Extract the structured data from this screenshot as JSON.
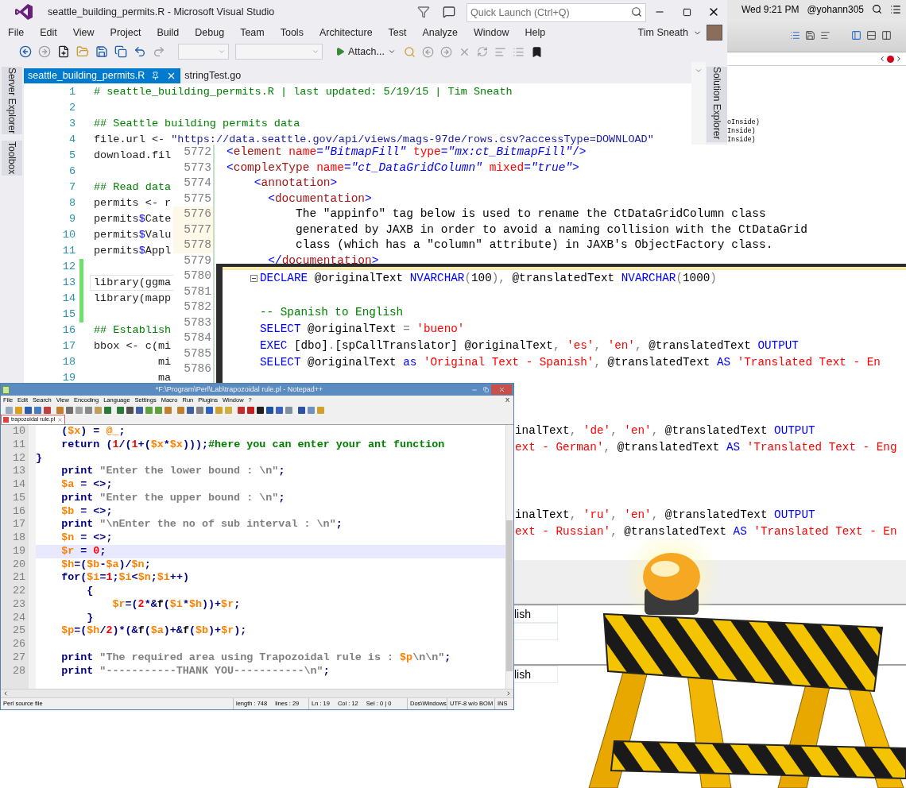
{
  "vs_window": {
    "title": "seattle_building_permits.R - Microsoft Visual Studio",
    "quick_launch": {
      "placeholder": "Quick Launch (Ctrl+Q)"
    },
    "menu": [
      "File",
      "Edit",
      "View",
      "Project",
      "Build",
      "Debug",
      "Team",
      "Tools",
      "Architecture",
      "Test",
      "Analyze",
      "Window",
      "Help"
    ],
    "user": "Tim Sneath",
    "toolbar": {
      "attach": "Attach..."
    },
    "tabs": [
      {
        "label": "seattle_building_permits.R",
        "selected": true
      },
      {
        "label": "stringTest.go",
        "selected": false
      }
    ],
    "left_tool_tabs": [
      "Server Explorer",
      "Toolbox"
    ],
    "right_tool_tab": "Solution Explorer",
    "editor": {
      "lines": [
        {
          "number": "1",
          "changed": false,
          "current": false,
          "tokens": [
            {
              "kind": "c",
              "text": "# seattle_building_permits.R | last updated: 5/19/15 | Tim Sneath"
            }
          ]
        },
        {
          "number": "2",
          "changed": false,
          "current": false
        },
        {
          "number": "3",
          "changed": false,
          "current": false,
          "tokens": [
            {
              "kind": "c",
              "text": "## Seattle building permits data"
            }
          ]
        },
        {
          "number": "4",
          "changed": false,
          "current": false,
          "tokens": [
            {
              "kind": "p",
              "text": "file.url <- "
            },
            {
              "kind": "s",
              "text": "\"https://data.seattle.gov/api/views/mags-97de/rows.csv?accessType=DOWNLOAD\""
            }
          ]
        },
        {
          "number": "5",
          "changed": false,
          "current": false,
          "tokens": [
            {
              "kind": "p",
              "text": "download.fil"
            }
          ]
        },
        {
          "number": "6",
          "changed": false,
          "current": false
        },
        {
          "number": "7",
          "changed": false,
          "current": false,
          "tokens": [
            {
              "kind": "c",
              "text": "## Read data"
            }
          ]
        },
        {
          "number": "8",
          "changed": false,
          "current": false,
          "tokens": [
            {
              "kind": "p",
              "text": "permits <- r"
            }
          ]
        },
        {
          "number": "9",
          "changed": false,
          "current": false,
          "tokens": [
            {
              "kind": "p",
              "text": "permits"
            },
            {
              "kind": "o",
              "text": "$"
            },
            {
              "kind": "p",
              "text": "Cate"
            }
          ]
        },
        {
          "number": "10",
          "changed": false,
          "current": false,
          "tokens": [
            {
              "kind": "p",
              "text": "permits"
            },
            {
              "kind": "o",
              "text": "$"
            },
            {
              "kind": "p",
              "text": "Valu"
            }
          ]
        },
        {
          "number": "11",
          "changed": false,
          "current": false,
          "tokens": [
            {
              "kind": "p",
              "text": "permits"
            },
            {
              "kind": "o",
              "text": "$"
            },
            {
              "kind": "p",
              "text": "Appl"
            }
          ]
        },
        {
          "number": "12",
          "changed": true,
          "current": false
        },
        {
          "number": "13",
          "changed": true,
          "current": true,
          "tokens": [
            {
              "kind": "p",
              "text": "library(ggma"
            }
          ]
        },
        {
          "number": "14",
          "changed": true,
          "current": false,
          "tokens": [
            {
              "kind": "p",
              "text": "library(mapp"
            }
          ]
        },
        {
          "number": "15",
          "changed": true,
          "current": false
        },
        {
          "number": "16",
          "changed": false,
          "current": false,
          "tokens": [
            {
              "kind": "c",
              "text": "## Establish"
            }
          ]
        },
        {
          "number": "17",
          "changed": false,
          "current": false,
          "tokens": [
            {
              "kind": "p",
              "text": "bbox <- c(mi"
            }
          ]
        },
        {
          "number": "18",
          "changed": false,
          "current": false,
          "tokens": [
            {
              "kind": "p",
              "text": "          mi"
            }
          ]
        },
        {
          "number": "19",
          "changed": false,
          "current": false,
          "tokens": [
            {
              "kind": "p",
              "text": "          ma"
            }
          ]
        }
      ]
    }
  },
  "mac_panel": {
    "clock": "Wed 9:21 PM",
    "user": "@yohann305",
    "code_fragments": [
      "oInside)",
      "Inside)",
      "Inside)"
    ]
  },
  "xml_window": {
    "lines": [
      {
        "number": "5772",
        "highlighted": false,
        "tokens": [
          {
            "kind": "b",
            "text": "<"
          },
          {
            "kind": "n",
            "text": "element "
          },
          {
            "kind": "a",
            "text": "name"
          },
          {
            "kind": "b",
            "text": "="
          },
          {
            "kind": "v",
            "text": "\"BitmapFill\""
          },
          {
            "kind": "a",
            "text": " type"
          },
          {
            "kind": "b",
            "text": "="
          },
          {
            "kind": "v",
            "text": "\"mx:ct_BitmapFill\""
          },
          {
            "kind": "b",
            "text": "/>"
          }
        ]
      },
      {
        "number": "5773",
        "highlighted": false,
        "tokens": [
          {
            "kind": "b",
            "text": "<"
          },
          {
            "kind": "n",
            "text": "complexType "
          },
          {
            "kind": "a",
            "text": "name"
          },
          {
            "kind": "b",
            "text": "="
          },
          {
            "kind": "v",
            "text": "\"ct_DataGridColumn\""
          },
          {
            "kind": "a",
            "text": " mixed"
          },
          {
            "kind": "b",
            "text": "="
          },
          {
            "kind": "v",
            "text": "\"true\""
          },
          {
            "kind": "b",
            "text": ">"
          }
        ]
      },
      {
        "number": "5774",
        "highlighted": false,
        "tokens": [
          {
            "kind": "b",
            "text": "    <"
          },
          {
            "kind": "n",
            "text": "annotation"
          },
          {
            "kind": "b",
            "text": ">"
          }
        ]
      },
      {
        "number": "5775",
        "highlighted": false,
        "tokens": [
          {
            "kind": "b",
            "text": "      <"
          },
          {
            "kind": "n",
            "text": "documentation"
          },
          {
            "kind": "b",
            "text": ">"
          }
        ]
      },
      {
        "number": "5776",
        "highlighted": true,
        "tokens": [
          {
            "kind": "p",
            "text": "          The \"appinfo\" tag below is used to rename the CtDataGridColumn class"
          }
        ]
      },
      {
        "number": "5777",
        "highlighted": true,
        "tokens": [
          {
            "kind": "p",
            "text": "          generated by JAXB in order to avoid a naming collision with the CtDataGrid"
          }
        ]
      },
      {
        "number": "5778",
        "highlighted": true,
        "tokens": [
          {
            "kind": "p",
            "text": "          class (which has a \"column\" attribute) in JAXB's ObjectFactory class."
          }
        ]
      },
      {
        "number": "5779",
        "highlighted": false,
        "tokens": [
          {
            "kind": "b",
            "text": "      </"
          },
          {
            "kind": "n",
            "text": "documentation"
          },
          {
            "kind": "b",
            "text": ">"
          }
        ]
      },
      {
        "number": "5780",
        "highlighted": false
      },
      {
        "number": "5781",
        "highlighted": false
      },
      {
        "number": "5782",
        "highlighted": false
      },
      {
        "number": "5783",
        "highlighted": false
      },
      {
        "number": "5784",
        "highlighted": false
      },
      {
        "number": "5785",
        "highlighted": false
      },
      {
        "number": "5786",
        "highlighted": false
      }
    ]
  },
  "sql_window": {
    "lines": [
      {
        "kind": "block_start",
        "tokens": [
          {
            "kind": "k",
            "text": "DECLARE"
          },
          {
            "kind": "p",
            "text": " @originalText "
          },
          {
            "kind": "k",
            "text": "NVARCHAR"
          },
          {
            "kind": "g",
            "text": "("
          },
          {
            "kind": "p",
            "text": "100"
          },
          {
            "kind": "g",
            "text": "),"
          },
          {
            "kind": "p",
            "text": " @translatedText "
          },
          {
            "kind": "k",
            "text": "NVARCHAR"
          },
          {
            "kind": "g",
            "text": "("
          },
          {
            "kind": "p",
            "text": "1000"
          },
          {
            "kind": "g",
            "text": ")"
          }
        ]
      },
      {
        "kind": "blank"
      },
      {
        "kind": "code",
        "tokens": [
          {
            "kind": "c",
            "text": "-- Spanish to English"
          }
        ]
      },
      {
        "kind": "code",
        "tokens": [
          {
            "kind": "k",
            "text": "SELECT"
          },
          {
            "kind": "p",
            "text": " @originalText "
          },
          {
            "kind": "g",
            "text": "= "
          },
          {
            "kind": "s",
            "text": "'bueno'"
          }
        ]
      },
      {
        "kind": "code",
        "tokens": [
          {
            "kind": "k",
            "text": "EXEC"
          },
          {
            "kind": "p",
            "text": " [dbo]"
          },
          {
            "kind": "g",
            "text": "."
          },
          {
            "kind": "p",
            "text": "[spCallTranslator] @originalText"
          },
          {
            "kind": "g",
            "text": ", "
          },
          {
            "kind": "s",
            "text": "'es'"
          },
          {
            "kind": "g",
            "text": ", "
          },
          {
            "kind": "s",
            "text": "'en'"
          },
          {
            "kind": "g",
            "text": ","
          },
          {
            "kind": "p",
            "text": " @translatedText "
          },
          {
            "kind": "k",
            "text": "OUTPUT"
          }
        ]
      },
      {
        "kind": "code",
        "tokens": [
          {
            "kind": "k",
            "text": "SELECT"
          },
          {
            "kind": "p",
            "text": " @originalText "
          },
          {
            "kind": "k",
            "text": "as"
          },
          {
            "kind": "s",
            "text": " 'Original Text - Spanish'"
          },
          {
            "kind": "g",
            "text": ","
          },
          {
            "kind": "p",
            "text": " @translatedText "
          },
          {
            "kind": "k",
            "text": "AS"
          },
          {
            "kind": "s",
            "text": " 'Translated Text - En"
          }
        ]
      },
      {
        "kind": "blank"
      },
      {
        "kind": "blank"
      },
      {
        "kind": "blank"
      },
      {
        "kind": "partial",
        "tokens": [
          {
            "kind": "p",
            "text": "inalText"
          },
          {
            "kind": "g",
            "text": ", "
          },
          {
            "kind": "s",
            "text": "'de'"
          },
          {
            "kind": "g",
            "text": ", "
          },
          {
            "kind": "s",
            "text": "'en'"
          },
          {
            "kind": "g",
            "text": ","
          },
          {
            "kind": "p",
            "text": " @translatedText "
          },
          {
            "kind": "k",
            "text": "OUTPUT"
          }
        ]
      },
      {
        "kind": "partial",
        "tokens": [
          {
            "kind": "s",
            "text": "ext - German'"
          },
          {
            "kind": "g",
            "text": ","
          },
          {
            "kind": "p",
            "text": " @translatedText "
          },
          {
            "kind": "k",
            "text": "AS"
          },
          {
            "kind": "s",
            "text": " 'Translated Text - Eng"
          }
        ]
      },
      {
        "kind": "blank"
      },
      {
        "kind": "blank"
      },
      {
        "kind": "blank"
      },
      {
        "kind": "partial",
        "tokens": [
          {
            "kind": "p",
            "text": "inalText"
          },
          {
            "kind": "g",
            "text": ", "
          },
          {
            "kind": "s",
            "text": "'ru'"
          },
          {
            "kind": "g",
            "text": ", "
          },
          {
            "kind": "s",
            "text": "'en'"
          },
          {
            "kind": "g",
            "text": ","
          },
          {
            "kind": "p",
            "text": " @translatedText "
          },
          {
            "kind": "k",
            "text": "OUTPUT"
          }
        ]
      },
      {
        "kind": "partial",
        "tokens": [
          {
            "kind": "s",
            "text": "ext - Russian'"
          },
          {
            "kind": "g",
            "text": ","
          },
          {
            "kind": "p",
            "text": " @translatedText "
          },
          {
            "kind": "k",
            "text": "AS"
          },
          {
            "kind": "s",
            "text": " 'Translated Text - En"
          }
        ]
      }
    ]
  },
  "results": {
    "cells": [
      "lish",
      "lish"
    ]
  },
  "notepad": {
    "title": "*F:\\Program\\Perl\\Lab\\trapozoidal rule.pl - Notepad++",
    "menu": [
      "File",
      "Edit",
      "Search",
      "View",
      "Encoding",
      "Language",
      "Settings",
      "Macro",
      "Run",
      "Plugins",
      "Window",
      "?"
    ],
    "doc_close": "X",
    "tabs": [
      {
        "label": "trapozoidal rule.pl",
        "selected": true
      }
    ],
    "editor": {
      "lines": [
        {
          "number": "10",
          "current": false,
          "tokens": [
            {
              "kind": "o",
              "text": "    ("
            },
            {
              "kind": "v",
              "text": "$x"
            },
            {
              "kind": "o",
              "text": ") = "
            },
            {
              "kind": "v",
              "text": "@_"
            },
            {
              "kind": "o",
              "text": ";"
            }
          ]
        },
        {
          "number": "11",
          "current": false,
          "tokens": [
            {
              "kind": "k",
              "text": "    return"
            },
            {
              "kind": "o",
              "text": " ("
            },
            {
              "kind": "n",
              "text": "1"
            },
            {
              "kind": "o",
              "text": "/("
            },
            {
              "kind": "n",
              "text": "1"
            },
            {
              "kind": "o",
              "text": "+("
            },
            {
              "kind": "v",
              "text": "$x"
            },
            {
              "kind": "o",
              "text": "*"
            },
            {
              "kind": "v",
              "text": "$x"
            },
            {
              "kind": "o",
              "text": ")));"
            },
            {
              "kind": "c",
              "text": "#here you can enter your ant function"
            }
          ]
        },
        {
          "number": "12",
          "current": false,
          "tokens": [
            {
              "kind": "o",
              "text": "}"
            }
          ]
        },
        {
          "number": "13",
          "current": false,
          "tokens": [
            {
              "kind": "k",
              "text": "    print"
            },
            {
              "kind": "s",
              "text": " \"Enter the lower bound : \\n\""
            },
            {
              "kind": "o",
              "text": ";"
            }
          ]
        },
        {
          "number": "14",
          "current": false,
          "tokens": [
            {
              "kind": "v",
              "text": "    $a"
            },
            {
              "kind": "o",
              "text": " = <>;"
            }
          ]
        },
        {
          "number": "15",
          "current": false,
          "tokens": [
            {
              "kind": "k",
              "text": "    print"
            },
            {
              "kind": "s",
              "text": " \"Enter the upper bound : \\n\""
            },
            {
              "kind": "o",
              "text": ";"
            }
          ]
        },
        {
          "number": "16",
          "current": false,
          "tokens": [
            {
              "kind": "v",
              "text": "    $b"
            },
            {
              "kind": "o",
              "text": " = <>;"
            }
          ]
        },
        {
          "number": "17",
          "current": false,
          "tokens": [
            {
              "kind": "k",
              "text": "    print"
            },
            {
              "kind": "s",
              "text": " \"\\nEnter the no of sub interval : \\n\""
            },
            {
              "kind": "o",
              "text": ";"
            }
          ]
        },
        {
          "number": "18",
          "current": false,
          "tokens": [
            {
              "kind": "v",
              "text": "    $n"
            },
            {
              "kind": "o",
              "text": " = <>;"
            }
          ]
        },
        {
          "number": "19",
          "current": true,
          "tokens": [
            {
              "kind": "v",
              "text": "    $r"
            },
            {
              "kind": "o",
              "text": " = "
            },
            {
              "kind": "n",
              "text": "0"
            },
            {
              "kind": "o",
              "text": ";"
            }
          ]
        },
        {
          "number": "20",
          "current": false,
          "tokens": [
            {
              "kind": "v",
              "text": "    $h"
            },
            {
              "kind": "o",
              "text": "=("
            },
            {
              "kind": "v",
              "text": "$b"
            },
            {
              "kind": "o",
              "text": "-"
            },
            {
              "kind": "v",
              "text": "$a"
            },
            {
              "kind": "o",
              "text": ")/"
            },
            {
              "kind": "v",
              "text": "$n"
            },
            {
              "kind": "o",
              "text": ";"
            }
          ]
        },
        {
          "number": "21",
          "current": false,
          "tokens": [
            {
              "kind": "k",
              "text": "    for"
            },
            {
              "kind": "o",
              "text": "("
            },
            {
              "kind": "v",
              "text": "$i"
            },
            {
              "kind": "o",
              "text": "="
            },
            {
              "kind": "n",
              "text": "1"
            },
            {
              "kind": "o",
              "text": ";"
            },
            {
              "kind": "v",
              "text": "$i"
            },
            {
              "kind": "o",
              "text": "<"
            },
            {
              "kind": "v",
              "text": "$n"
            },
            {
              "kind": "o",
              "text": ";"
            },
            {
              "kind": "v",
              "text": "$i"
            },
            {
              "kind": "o",
              "text": "++)"
            }
          ]
        },
        {
          "number": "22",
          "current": false,
          "tokens": [
            {
              "kind": "o",
              "text": "        {"
            }
          ]
        },
        {
          "number": "23",
          "current": false,
          "tokens": [
            {
              "kind": "v",
              "text": "            $r"
            },
            {
              "kind": "o",
              "text": "=("
            },
            {
              "kind": "n",
              "text": "2"
            },
            {
              "kind": "o",
              "text": "*&"
            },
            {
              "kind": "p",
              "text": "f"
            },
            {
              "kind": "o",
              "text": "("
            },
            {
              "kind": "v",
              "text": "$i"
            },
            {
              "kind": "o",
              "text": "*"
            },
            {
              "kind": "v",
              "text": "$h"
            },
            {
              "kind": "o",
              "text": "))+"
            },
            {
              "kind": "v",
              "text": "$r"
            },
            {
              "kind": "o",
              "text": ";"
            }
          ]
        },
        {
          "number": "24",
          "current": false,
          "tokens": [
            {
              "kind": "o",
              "text": "        }"
            }
          ]
        },
        {
          "number": "25",
          "current": false,
          "tokens": [
            {
              "kind": "v",
              "text": "    $p"
            },
            {
              "kind": "o",
              "text": "=("
            },
            {
              "kind": "v",
              "text": "$h"
            },
            {
              "kind": "o",
              "text": "/"
            },
            {
              "kind": "n",
              "text": "2"
            },
            {
              "kind": "o",
              "text": ")*(&"
            },
            {
              "kind": "p",
              "text": "f"
            },
            {
              "kind": "o",
              "text": "("
            },
            {
              "kind": "v",
              "text": "$a"
            },
            {
              "kind": "o",
              "text": ")+&"
            },
            {
              "kind": "p",
              "text": "f"
            },
            {
              "kind": "o",
              "text": "("
            },
            {
              "kind": "v",
              "text": "$b"
            },
            {
              "kind": "o",
              "text": ")+"
            },
            {
              "kind": "v",
              "text": "$r"
            },
            {
              "kind": "o",
              "text": ");"
            }
          ]
        },
        {
          "number": "26",
          "current": false
        },
        {
          "number": "27",
          "current": false,
          "tokens": [
            {
              "kind": "k",
              "text": "    print"
            },
            {
              "kind": "s",
              "text": " \"The required area using Trapozoidal rule is : "
            },
            {
              "kind": "v",
              "text": "$p"
            },
            {
              "kind": "s",
              "text": "\\n\\n\""
            },
            {
              "kind": "o",
              "text": ";"
            }
          ]
        },
        {
          "number": "28",
          "current": false,
          "tokens": [
            {
              "kind": "k",
              "text": "    print"
            },
            {
              "kind": "s",
              "text": " \"-----------THANK YOU-----------\\n\""
            },
            {
              "kind": "o",
              "text": ";"
            }
          ]
        }
      ]
    },
    "status_bar": [
      [
        "Perl source file"
      ],
      [
        "length : 748",
        "lines : 29"
      ],
      [
        "Ln : 19",
        "Col : 12",
        "Sel : 0 | 0"
      ],
      [
        "Dos\\Windows"
      ],
      [
        "UTF-8 w/o BOM"
      ],
      [
        "INS"
      ]
    ]
  }
}
